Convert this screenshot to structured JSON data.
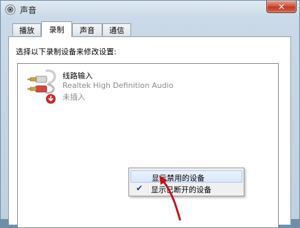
{
  "window": {
    "title": "声音",
    "title_icon": "speaker-icon",
    "close_label": "✕"
  },
  "tabs": [
    {
      "label": "播放",
      "active": false
    },
    {
      "label": "录制",
      "active": true
    },
    {
      "label": "声音",
      "active": false
    },
    {
      "label": "通信",
      "active": false
    }
  ],
  "panel": {
    "instruction": "选择以下录制设备来修改设置:"
  },
  "device": {
    "name": "线路输入",
    "driver": "Realtek High Definition Audio",
    "status": "未插入",
    "icon": "rca-cable-icon",
    "status_icon": "unplugged-down-arrow-icon"
  },
  "context_menu": {
    "items": [
      {
        "label": "显示禁用的设备",
        "checked": false,
        "highlighted": true
      },
      {
        "label": "显示已断开的设备",
        "checked": true,
        "highlighted": false
      }
    ],
    "check_glyph": "✔"
  },
  "annotation": {
    "icon": "red-arrow-icon",
    "color": "#c0141c"
  }
}
